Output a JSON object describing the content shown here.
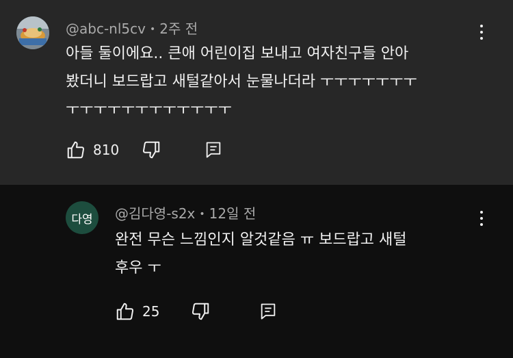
{
  "comments": [
    {
      "author": "@abc-nl5cv",
      "time": "2주 전",
      "text_line1": "아들 둘이에요.. 큰애 어린이집 보내고 여자친구들 안아",
      "text_line2": "봤더니 보드랍고 새털같아서 눈물나더라 ㅜㅜㅜㅜㅜㅜㅜ",
      "text_line3": "ㅜㅜㅜㅜㅜㅜㅜㅜㅜㅜㅜㅜ",
      "likes": "810",
      "avatar_type": "photo"
    },
    {
      "author": "@김다영-s2x",
      "time": "12일 전",
      "avatar_initials": "다영",
      "text_line1": "완전 무슨 느낌인지 알것같음 ㅠ 보드랍고 새털",
      "text_line2": "후우 ㅜ",
      "likes": "25"
    }
  ],
  "icons": [
    "thumbs-up-icon",
    "thumbs-down-icon",
    "reply-icon",
    "more-vert-icon"
  ],
  "colors": {
    "top_bg": "#272727",
    "bottom_bg": "#0f0f0f",
    "avatar2_bg": "#1d4d3e"
  }
}
